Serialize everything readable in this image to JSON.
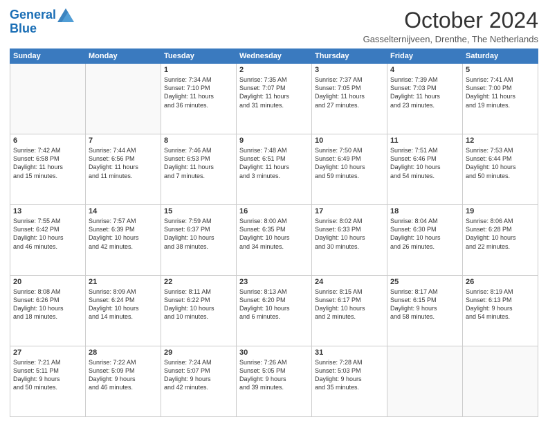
{
  "header": {
    "logo_line1": "General",
    "logo_line2": "Blue",
    "month_title": "October 2024",
    "location": "Gasselternijveen, Drenthe, The Netherlands"
  },
  "days_of_week": [
    "Sunday",
    "Monday",
    "Tuesday",
    "Wednesday",
    "Thursday",
    "Friday",
    "Saturday"
  ],
  "weeks": [
    [
      {
        "day": "",
        "info": ""
      },
      {
        "day": "",
        "info": ""
      },
      {
        "day": "1",
        "info": "Sunrise: 7:34 AM\nSunset: 7:10 PM\nDaylight: 11 hours\nand 36 minutes."
      },
      {
        "day": "2",
        "info": "Sunrise: 7:35 AM\nSunset: 7:07 PM\nDaylight: 11 hours\nand 31 minutes."
      },
      {
        "day": "3",
        "info": "Sunrise: 7:37 AM\nSunset: 7:05 PM\nDaylight: 11 hours\nand 27 minutes."
      },
      {
        "day": "4",
        "info": "Sunrise: 7:39 AM\nSunset: 7:03 PM\nDaylight: 11 hours\nand 23 minutes."
      },
      {
        "day": "5",
        "info": "Sunrise: 7:41 AM\nSunset: 7:00 PM\nDaylight: 11 hours\nand 19 minutes."
      }
    ],
    [
      {
        "day": "6",
        "info": "Sunrise: 7:42 AM\nSunset: 6:58 PM\nDaylight: 11 hours\nand 15 minutes."
      },
      {
        "day": "7",
        "info": "Sunrise: 7:44 AM\nSunset: 6:56 PM\nDaylight: 11 hours\nand 11 minutes."
      },
      {
        "day": "8",
        "info": "Sunrise: 7:46 AM\nSunset: 6:53 PM\nDaylight: 11 hours\nand 7 minutes."
      },
      {
        "day": "9",
        "info": "Sunrise: 7:48 AM\nSunset: 6:51 PM\nDaylight: 11 hours\nand 3 minutes."
      },
      {
        "day": "10",
        "info": "Sunrise: 7:50 AM\nSunset: 6:49 PM\nDaylight: 10 hours\nand 59 minutes."
      },
      {
        "day": "11",
        "info": "Sunrise: 7:51 AM\nSunset: 6:46 PM\nDaylight: 10 hours\nand 54 minutes."
      },
      {
        "day": "12",
        "info": "Sunrise: 7:53 AM\nSunset: 6:44 PM\nDaylight: 10 hours\nand 50 minutes."
      }
    ],
    [
      {
        "day": "13",
        "info": "Sunrise: 7:55 AM\nSunset: 6:42 PM\nDaylight: 10 hours\nand 46 minutes."
      },
      {
        "day": "14",
        "info": "Sunrise: 7:57 AM\nSunset: 6:39 PM\nDaylight: 10 hours\nand 42 minutes."
      },
      {
        "day": "15",
        "info": "Sunrise: 7:59 AM\nSunset: 6:37 PM\nDaylight: 10 hours\nand 38 minutes."
      },
      {
        "day": "16",
        "info": "Sunrise: 8:00 AM\nSunset: 6:35 PM\nDaylight: 10 hours\nand 34 minutes."
      },
      {
        "day": "17",
        "info": "Sunrise: 8:02 AM\nSunset: 6:33 PM\nDaylight: 10 hours\nand 30 minutes."
      },
      {
        "day": "18",
        "info": "Sunrise: 8:04 AM\nSunset: 6:30 PM\nDaylight: 10 hours\nand 26 minutes."
      },
      {
        "day": "19",
        "info": "Sunrise: 8:06 AM\nSunset: 6:28 PM\nDaylight: 10 hours\nand 22 minutes."
      }
    ],
    [
      {
        "day": "20",
        "info": "Sunrise: 8:08 AM\nSunset: 6:26 PM\nDaylight: 10 hours\nand 18 minutes."
      },
      {
        "day": "21",
        "info": "Sunrise: 8:09 AM\nSunset: 6:24 PM\nDaylight: 10 hours\nand 14 minutes."
      },
      {
        "day": "22",
        "info": "Sunrise: 8:11 AM\nSunset: 6:22 PM\nDaylight: 10 hours\nand 10 minutes."
      },
      {
        "day": "23",
        "info": "Sunrise: 8:13 AM\nSunset: 6:20 PM\nDaylight: 10 hours\nand 6 minutes."
      },
      {
        "day": "24",
        "info": "Sunrise: 8:15 AM\nSunset: 6:17 PM\nDaylight: 10 hours\nand 2 minutes."
      },
      {
        "day": "25",
        "info": "Sunrise: 8:17 AM\nSunset: 6:15 PM\nDaylight: 9 hours\nand 58 minutes."
      },
      {
        "day": "26",
        "info": "Sunrise: 8:19 AM\nSunset: 6:13 PM\nDaylight: 9 hours\nand 54 minutes."
      }
    ],
    [
      {
        "day": "27",
        "info": "Sunrise: 7:21 AM\nSunset: 5:11 PM\nDaylight: 9 hours\nand 50 minutes."
      },
      {
        "day": "28",
        "info": "Sunrise: 7:22 AM\nSunset: 5:09 PM\nDaylight: 9 hours\nand 46 minutes."
      },
      {
        "day": "29",
        "info": "Sunrise: 7:24 AM\nSunset: 5:07 PM\nDaylight: 9 hours\nand 42 minutes."
      },
      {
        "day": "30",
        "info": "Sunrise: 7:26 AM\nSunset: 5:05 PM\nDaylight: 9 hours\nand 39 minutes."
      },
      {
        "day": "31",
        "info": "Sunrise: 7:28 AM\nSunset: 5:03 PM\nDaylight: 9 hours\nand 35 minutes."
      },
      {
        "day": "",
        "info": ""
      },
      {
        "day": "",
        "info": ""
      }
    ]
  ]
}
